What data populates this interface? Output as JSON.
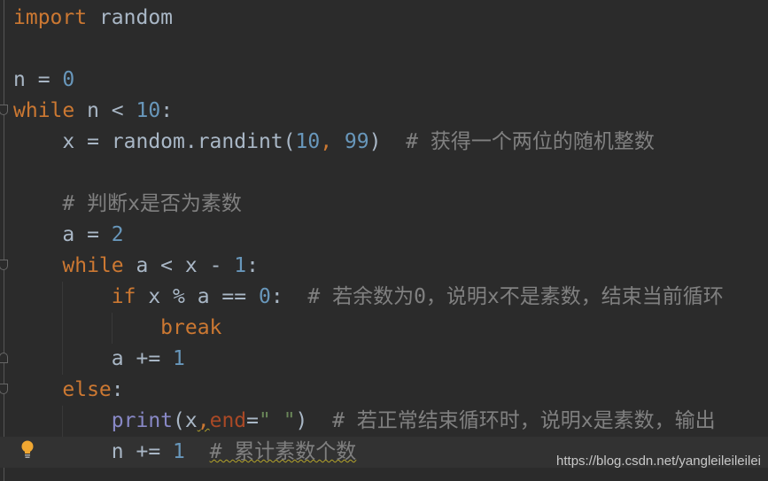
{
  "editor": {
    "current_line": 14,
    "lines": [
      [
        {
          "t": "import",
          "c": "kw"
        },
        {
          "t": " random"
        }
      ],
      [],
      [
        {
          "t": "n = "
        },
        {
          "t": "0",
          "c": "num"
        }
      ],
      [
        {
          "t": "while",
          "c": "kw"
        },
        {
          "t": " n < "
        },
        {
          "t": "10",
          "c": "num"
        },
        {
          "t": ":"
        }
      ],
      [
        {
          "t": "    x = random.randint("
        },
        {
          "t": "10",
          "c": "num"
        },
        {
          "t": ", ",
          "c": "kw"
        },
        {
          "t": "99",
          "c": "num"
        },
        {
          "t": ")  "
        },
        {
          "t": "# 获得一个两位的随机整数",
          "c": "cm"
        }
      ],
      [],
      [
        {
          "t": "    "
        },
        {
          "t": "# 判断x是否为素数",
          "c": "cm"
        }
      ],
      [
        {
          "t": "    a = "
        },
        {
          "t": "2",
          "c": "num"
        }
      ],
      [
        {
          "t": "    "
        },
        {
          "t": "while",
          "c": "kw"
        },
        {
          "t": " a < x - "
        },
        {
          "t": "1",
          "c": "num"
        },
        {
          "t": ":"
        }
      ],
      [
        {
          "t": "        "
        },
        {
          "t": "if",
          "c": "kw"
        },
        {
          "t": " x % a == "
        },
        {
          "t": "0",
          "c": "num"
        },
        {
          "t": ":  "
        },
        {
          "t": "# 若余数为0，说明x不是素数，结束当前循环",
          "c": "cm"
        }
      ],
      [
        {
          "t": "            "
        },
        {
          "t": "break",
          "c": "kw"
        }
      ],
      [
        {
          "t": "        a += "
        },
        {
          "t": "1",
          "c": "num"
        }
      ],
      [
        {
          "t": "    "
        },
        {
          "t": "else",
          "c": "kw"
        },
        {
          "t": ":"
        }
      ],
      [
        {
          "t": "        "
        },
        {
          "t": "print",
          "c": "bi"
        },
        {
          "t": "(x"
        },
        {
          "t": ",",
          "c": "kw warn"
        },
        {
          "t": "end",
          "c": "kwarg"
        },
        {
          "t": "="
        },
        {
          "t": "\" \"",
          "c": "str"
        },
        {
          "t": ")  "
        },
        {
          "t": "# 若正常结束循环时，说明x是素数，输出",
          "c": "cm"
        }
      ],
      [
        {
          "t": "        n += "
        },
        {
          "t": "1",
          "c": "num"
        },
        {
          "t": "  "
        },
        {
          "t": "# 累计素数个数",
          "c": "cm warn"
        }
      ]
    ]
  },
  "icons": {
    "intention": "lightbulb-icon"
  },
  "watermark": "https://blog.csdn.net/yangleileileilei"
}
